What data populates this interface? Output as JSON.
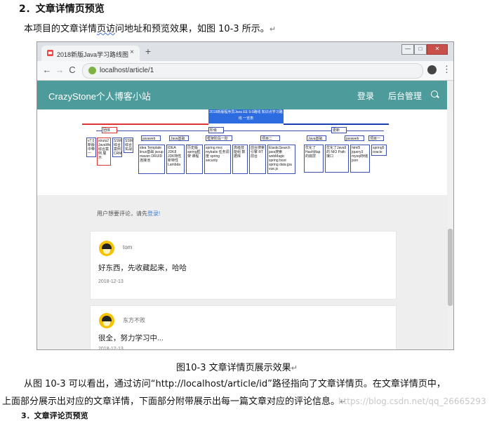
{
  "doc": {
    "heading": "2．文章详情页预览",
    "intro_prefix": "本项目的文章详情",
    "intro_squiggle": "页访",
    "intro_suffix": "问地址和预览效果，如图 10-3 所示。",
    "para_mark": "↵",
    "caption": "图10-3    文章详情页展示效果",
    "para_line1": "从图 10-3 可以看出，通过访问“http://localhost/article/id”路径指向了文章详情页。在文章详情页中，",
    "para_line2": "上面部分展示出对应的文章详情，下面部分附带展示出每一篇文章对应的评论信息。",
    "watermark": "https://blog.csdn.net/qq_26665293",
    "next_heading": "3．文章评论页预览"
  },
  "browser": {
    "tab_title": "2018新版Java学习路线图",
    "tab_close": "×",
    "new_tab": "+",
    "win_min": "—",
    "win_max": "□",
    "win_close": "✕",
    "back": "←",
    "forward": "→",
    "reload": "C",
    "url": "localhost/article/1",
    "menu": "⋮"
  },
  "site": {
    "title": "CrazyStone个人博客小站",
    "nav_login": "登录",
    "nav_admin": "后台管理",
    "comment_prompt": "用户想要评论，请先",
    "comment_login_link": "登录!"
  },
  "mindmap": {
    "root": "2018新版程序员Java EE 9.0路线 知识点学习路线 一览表",
    "branches": [
      "团体",
      "阶级",
      "更新"
    ],
    "nodes": [
      "v7.0 新版 中带一",
      "struts2 JavaWeb 综合案例 展示",
      "SSM 综合 案例 CRM",
      "SSM 综合 实战",
      "javaweb",
      "Java基础",
      "框架阶段一阶段",
      "项目二",
      "Java基础",
      "javaweb",
      "项目一",
      "idea Template linux基础 jsoup maven DRUID连接池",
      "IDEA JDK8 JDK特性 新特性 Lambda",
      "历史版 spring框架 课程",
      "spring mvc mybatis 任务调度 spring security",
      "高级技 能组 数据库",
      "前台搜索引擎 RT 前台",
      "ElasticSearch java搜索 webMagic spring boot spring data jpa vue.js",
      "优化了 HashMap 的底层",
      "优化了Java9 的 NIO Path接口",
      "html5 jquery3 mysql存储 json",
      "spring5 oracle"
    ]
  },
  "comments": [
    {
      "user": "tom",
      "text": "好东西，先收藏起来，哈哈",
      "date": "2018-12-13"
    },
    {
      "user": "东方不败",
      "text": "很全，努力学习中...",
      "date": "2018-12-13"
    }
  ]
}
